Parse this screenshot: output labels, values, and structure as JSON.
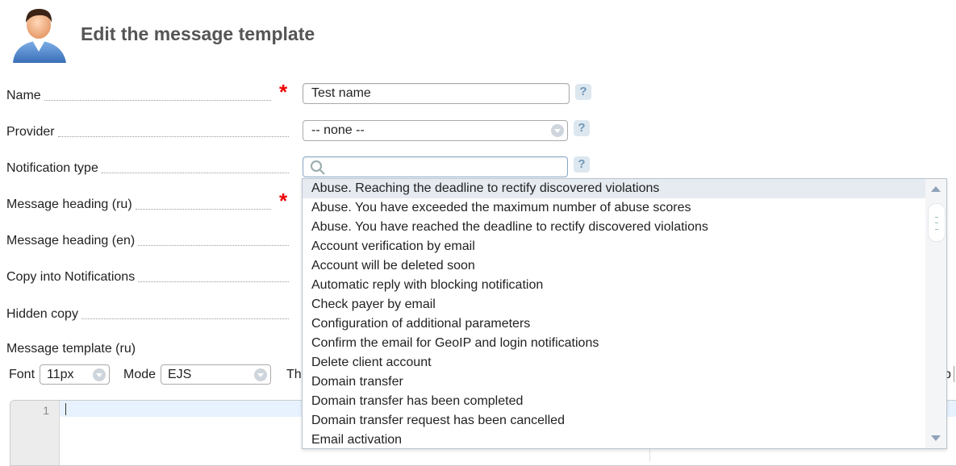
{
  "header": {
    "title": "Edit the message template"
  },
  "form": {
    "name_label": "Name",
    "name_value": "Test name",
    "provider_label": "Provider",
    "provider_value": "-- none --",
    "notification_type_label": "Notification type",
    "notification_type_search": "",
    "heading_ru_label": "Message heading (ru)",
    "heading_en_label": "Message heading (en)",
    "copy_notifications_label": "Copy into Notifications",
    "hidden_copy_label": "Hidden copy",
    "template_ru_label": "Message template (ru)",
    "required_mark": "*",
    "help_mark": "?"
  },
  "toolbar": {
    "font_label": "Font",
    "font_value": "11px",
    "mode_label": "Mode",
    "mode_value": "EJS",
    "theme_label_partial": "Th",
    "right_partial": "p"
  },
  "editor": {
    "line_number": "1"
  },
  "dropdown": {
    "items": [
      "Abuse. Reaching the deadline to rectify discovered violations",
      "Abuse. You have exceeded the maximum number of abuse scores",
      "Abuse. You have reached the deadline to rectify discovered violations",
      "Account verification by email",
      "Account will be deleted soon",
      "Automatic reply with blocking notification",
      "Check payer by email",
      "Configuration of additional parameters",
      "Confirm the email for GeoIP and login notifications",
      "Delete client account",
      "Domain transfer",
      "Domain transfer has been completed",
      "Domain transfer request has been cancelled",
      "Email activation"
    ],
    "highlighted_index": 0
  },
  "colors": {
    "required": "#e00000",
    "help_bg": "#dde7ef",
    "help_fg": "#6f96b8",
    "highlight": "#e6ebf1"
  }
}
